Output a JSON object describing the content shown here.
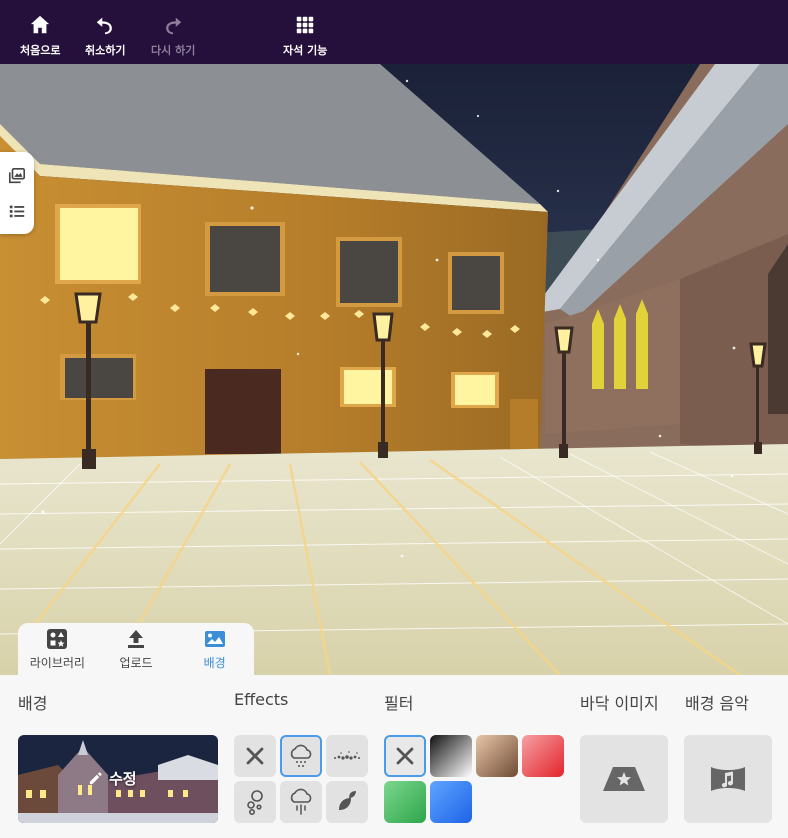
{
  "toolbar": {
    "home_label": "처음으로",
    "undo_label": "취소하기",
    "redo_label": "다시 하기",
    "magnet_label": "자석 기능"
  },
  "tabs": [
    {
      "label": "라이브러리",
      "icon": "library-icon",
      "active": false
    },
    {
      "label": "업로드",
      "icon": "upload-icon",
      "active": false
    },
    {
      "label": "배경",
      "icon": "background-icon",
      "active": true
    }
  ],
  "panel": {
    "background_title": "배경",
    "background_edit_label": "수정",
    "effects_title": "Effects",
    "filter_title": "필터",
    "floor_image_title": "바닥 이미지",
    "bg_music_title": "배경 음악"
  },
  "effects": [
    {
      "name": "none",
      "icon": "x-icon",
      "selected": false
    },
    {
      "name": "snow",
      "icon": "snow-cloud-icon",
      "selected": true
    },
    {
      "name": "particles",
      "icon": "dots-icon",
      "selected": false
    },
    {
      "name": "bubbles",
      "icon": "bubbles-icon",
      "selected": false
    },
    {
      "name": "rain",
      "icon": "rain-cloud-icon",
      "selected": false
    },
    {
      "name": "leaves",
      "icon": "leaf-icon",
      "selected": false
    }
  ],
  "filters": [
    {
      "name": "none",
      "selected": true,
      "colors": [
        "#e8e8e8",
        "#e8e8e8"
      ]
    },
    {
      "name": "grayscale",
      "selected": false,
      "colors": [
        "#ffffff",
        "#111111"
      ]
    },
    {
      "name": "sepia",
      "selected": false,
      "colors": [
        "#6e4a35",
        "#e8c7a8"
      ]
    },
    {
      "name": "red",
      "selected": false,
      "colors": [
        "#e3242b",
        "#f5a0a3"
      ]
    },
    {
      "name": "green",
      "selected": false,
      "colors": [
        "#2da64a",
        "#7dd68e"
      ]
    },
    {
      "name": "blue",
      "selected": false,
      "colors": [
        "#1d63e8",
        "#5fa5ff"
      ]
    }
  ],
  "colors": {
    "toolbar_bg": "#250f3b",
    "accent": "#3b8fd6",
    "selected_border": "#4b9be8"
  }
}
